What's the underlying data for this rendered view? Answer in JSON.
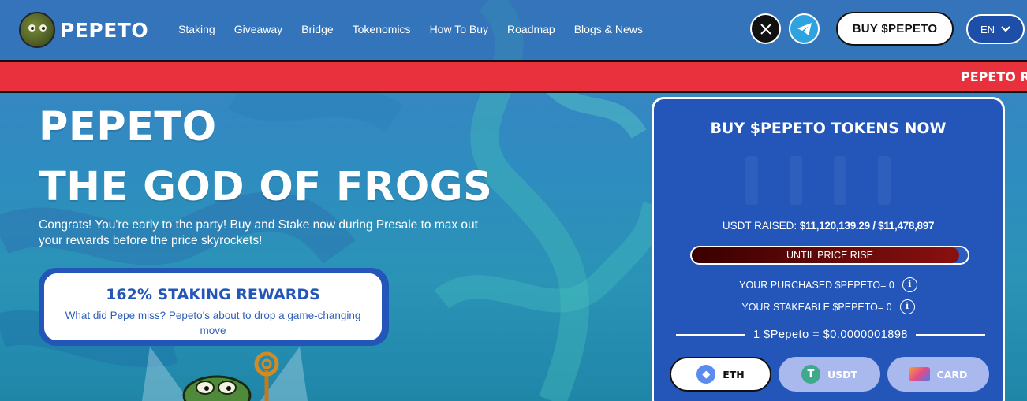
{
  "header": {
    "logo_text": "PEPETO",
    "nav": [
      "Staking",
      "Giveaway",
      "Bridge",
      "Tokenomics",
      "How To Buy",
      "Roadmap",
      "Blogs & News"
    ],
    "buy_button": "BUY $PEPETO",
    "language": "EN"
  },
  "ticker": {
    "text": "PEPETO R"
  },
  "hero": {
    "title_line1": "PEPETO",
    "title_line2": "THE GOD OF FROGS",
    "subtitle": "Congrats! You're early to the party! Buy and Stake now during Presale to max out your rewards before the price skyrockets!",
    "staking": {
      "title": "162% STAKING REWARDS",
      "description": "What did Pepe miss? Pepeto's about to drop a game-changing move"
    }
  },
  "widget": {
    "title": "BUY $PEPETO TOKENS NOW",
    "raised_label": "USDT RAISED:",
    "raised_value": "$11,120,139.29 / $11,478,897",
    "progress_label": "UNTIL PRICE RISE",
    "progress_fraction": 0.969,
    "purchased": "YOUR PURCHASED $PEPETO= 0",
    "stakeable": "YOUR STAKEABLE $PEPETO= 0",
    "price": "1 $Pepeto = $0.0000001898",
    "pay_options": [
      "ETH",
      "USDT",
      "CARD"
    ]
  },
  "colors": {
    "accent_blue": "#2356b8",
    "ticker_red": "#e8313d",
    "progress_dark_red": "#6a0a0a"
  }
}
